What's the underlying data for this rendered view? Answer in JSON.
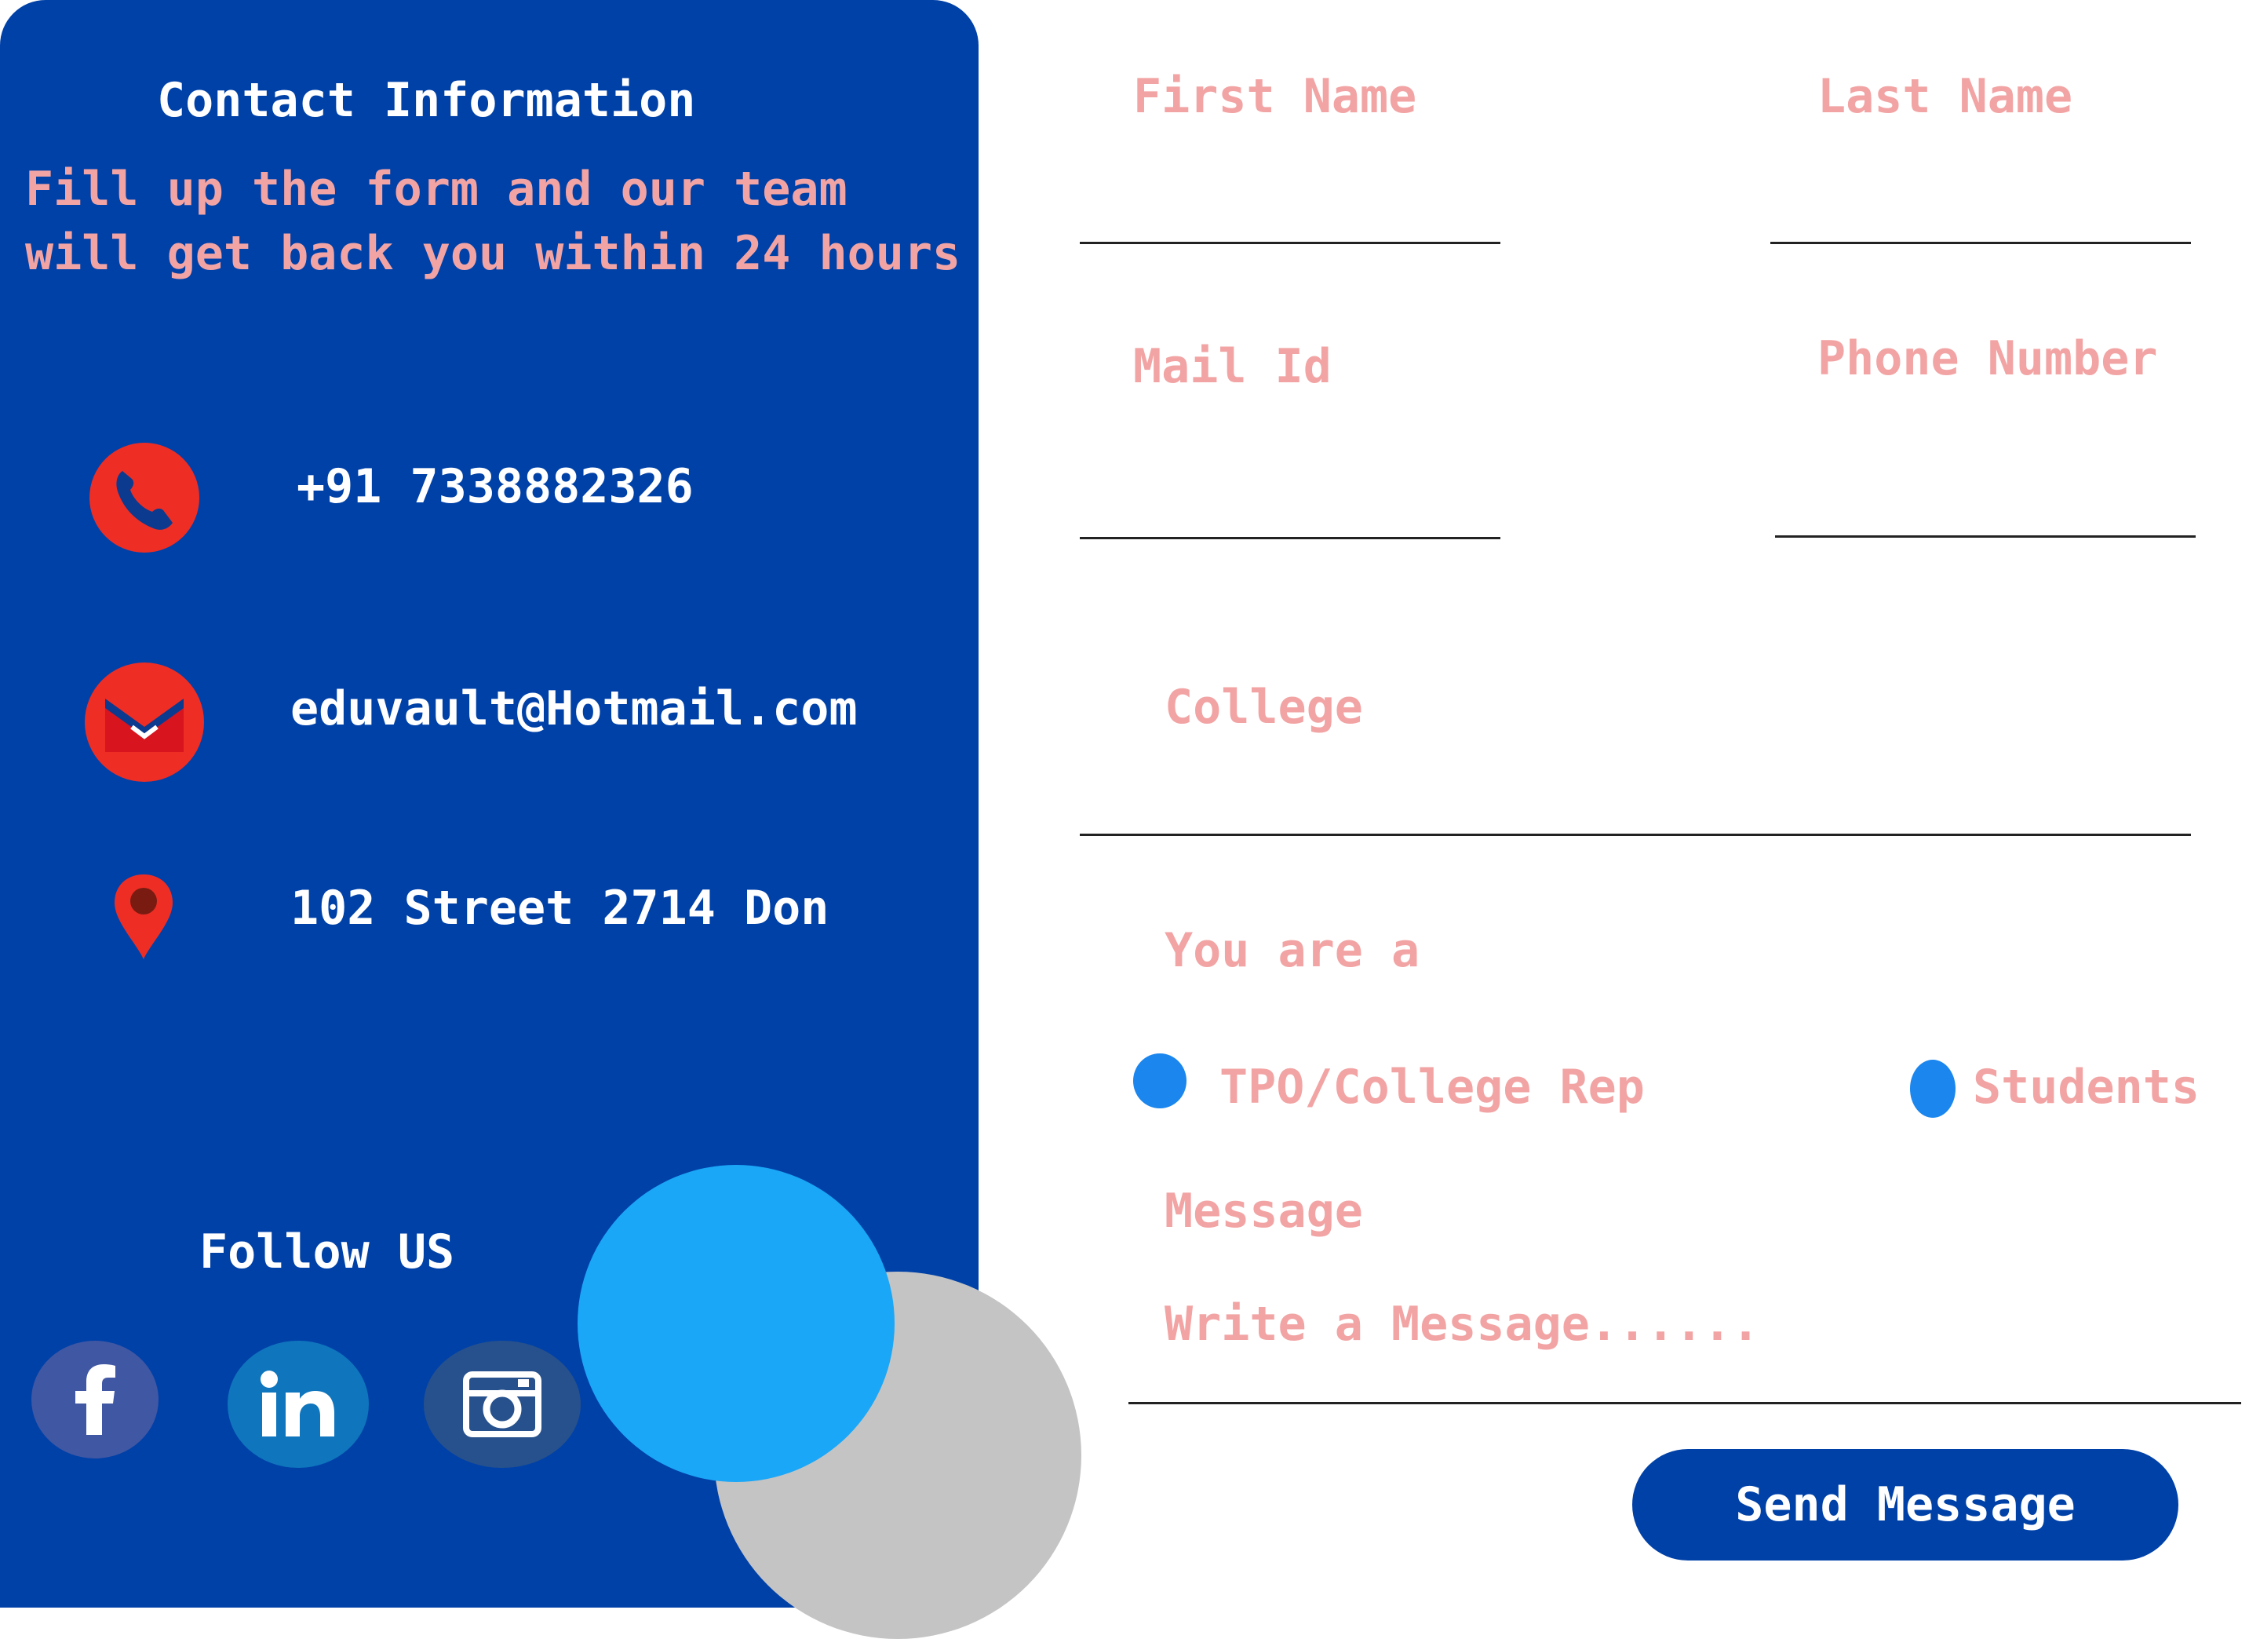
{
  "contact_panel": {
    "title": "Contact Information",
    "subtitle": "Fill up the form and our team\nwill get back you within 24 hours",
    "phone": "+91 7338882326",
    "email": "eduvault@Hotmail.com",
    "address": "102 Street 2714 Don",
    "follow_title": "Follow US",
    "socials": [
      {
        "name": "facebook",
        "icon": "facebook-icon"
      },
      {
        "name": "linkedin",
        "icon": "linkedin-icon"
      },
      {
        "name": "instagram",
        "icon": "instagram-icon"
      }
    ]
  },
  "form": {
    "first_name_label": "First Name",
    "last_name_label": "Last Name",
    "mail_label": "Mail Id",
    "phone_label": "Phone Number",
    "college_label": "College",
    "role_label": "You are a",
    "role_options": [
      "TPO/College Rep",
      "Students"
    ],
    "message_label": "Message",
    "message_placeholder": "Write a Message......",
    "send_label": "Send Message"
  },
  "colors": {
    "panel_blue": "#0041a8",
    "label_pink": "#f2a4a4",
    "radio_blue": "#1a86ee",
    "accent_circle_blue": "#1aa7f7",
    "accent_circle_gray": "#c4c4c4"
  }
}
